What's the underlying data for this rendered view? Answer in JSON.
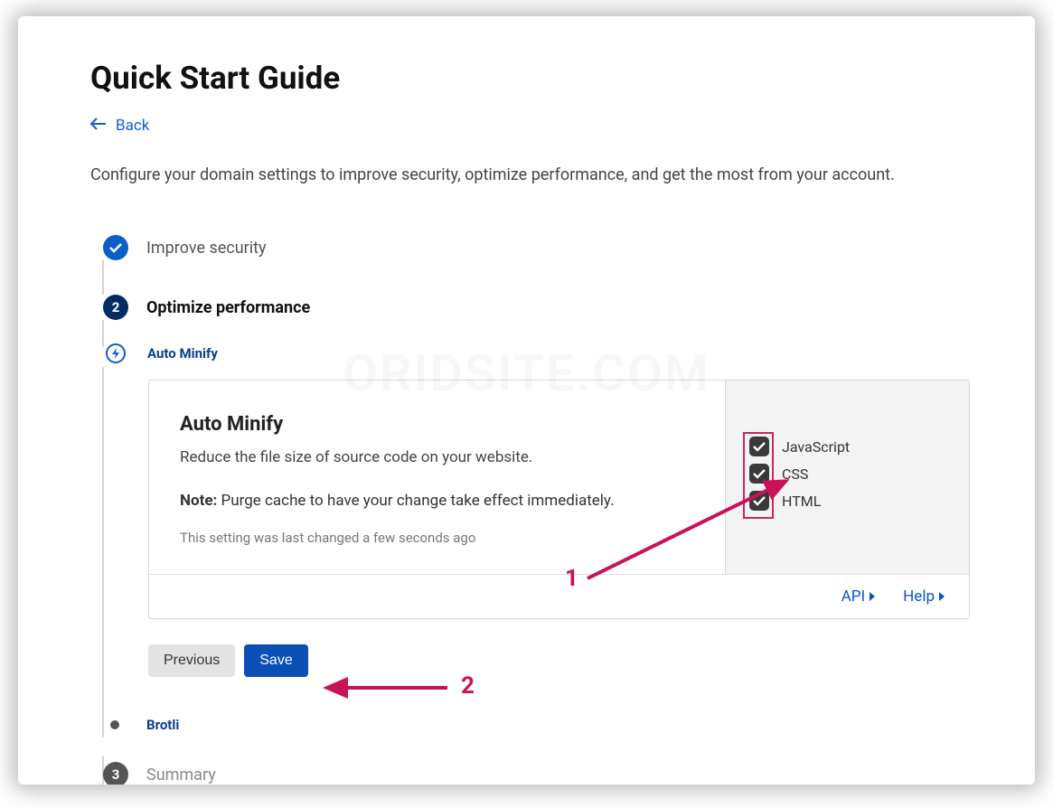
{
  "page_title": "Quick Start Guide",
  "back_label": "Back",
  "intro_text": "Configure your domain settings to improve security, optimize performance, and get the most from your account.",
  "watermark": "ORIDSITE.COM",
  "steps": {
    "s1": {
      "label": "Improve security"
    },
    "s2": {
      "number": "2",
      "label": "Optimize performance"
    },
    "sub_auto": {
      "label": "Auto Minify"
    },
    "sub_brotli": {
      "label": "Brotli"
    },
    "s3": {
      "number": "3",
      "label": "Summary"
    }
  },
  "card": {
    "title": "Auto Minify",
    "description": "Reduce the file size of source code on your website.",
    "note_label": "Note:",
    "note_text": " Purge cache to have your change take effect immediately.",
    "last_changed": "This setting was last changed a few seconds ago",
    "checkboxes": {
      "js": {
        "label": "JavaScript",
        "checked": true
      },
      "css": {
        "label": "CSS",
        "checked": true
      },
      "html": {
        "label": "HTML",
        "checked": true
      }
    },
    "footer": {
      "api": "API",
      "help": "Help"
    }
  },
  "buttons": {
    "previous": "Previous",
    "save": "Save"
  },
  "annotations": {
    "one": "1",
    "two": "2"
  },
  "colors": {
    "accent": "#0a55c4",
    "anno": "#c91259"
  }
}
